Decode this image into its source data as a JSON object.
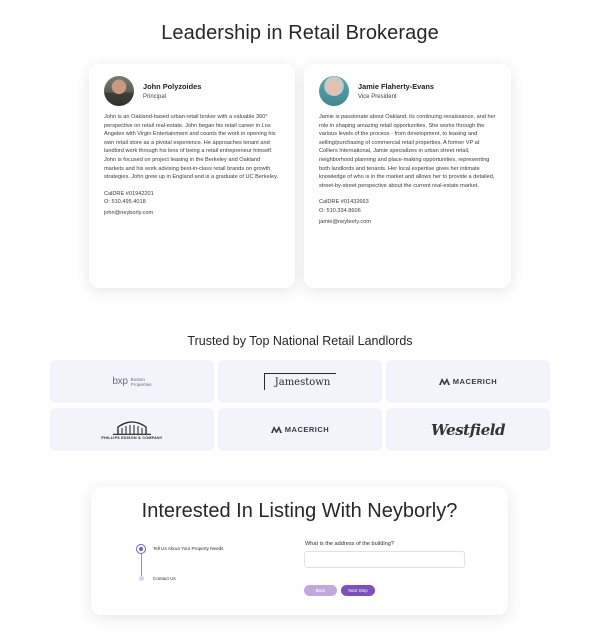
{
  "leadership": {
    "title": "Leadership in Retail Brokerage",
    "people": [
      {
        "name": "John Polyzoides",
        "role": "Principal",
        "bio": "John is an Oakland-based urban retail broker with a valuable 360° perspective on retail real-estate. John began his retail career in Los Angeles with Virgin Entertainment and counts the work in opening his own retail store as a pivotal experience. He approaches tenant and landlord work through his lens of being a retail entrepreneur himself. John is focused on project leasing in the Berkeley and Oakland markets and his work advising best-in-class retail brands on growth strategies. John grew up in England and is a graduate of UC Berkeley.",
        "license": "CalDRE #01942201",
        "phone": "O: 510.495.4018",
        "email": "john@neyborly.com"
      },
      {
        "name": "Jamie Flaherty-Evans",
        "role": "Vice President",
        "bio": "Jamie is passionate about Oakland, its continuing renaissance, and her role in shaping amazing retail opportunities. She works through the various levels of the process - from development, to leasing and selling/purchasing of commercial retail properties. A former VP at Colliers International, Jamie specializes in urban street retail, neighborhood planning and place-making opportunities, representing both landlords and tenants. Her local expertise gives her intimate knowledge of who is in the market and allows her to provide a detailed, street-by-street perspective about the current real-estate market.",
        "license": "CalDRE #01432663",
        "phone": "O: 510.334.8606",
        "email": "jamie@neyborly.com"
      }
    ]
  },
  "landlords": {
    "title": "Trusted by Top National Retail Landlords",
    "logos": {
      "bxp_mark": "bxp",
      "bxp_line1": "Boston",
      "bxp_line2": "Properties",
      "jamestown": "Jamestown",
      "macerich": "MACERICH",
      "phillips": "PHILLIPS EDISON & COMPANY",
      "westfield": "Westfield"
    }
  },
  "listing": {
    "title": "Interested In Listing With Neyborly?",
    "steps": [
      "Tell Us About Your Property Needs",
      "Contact Us"
    ],
    "question": "What is the address of the building?",
    "input_value": "",
    "input_placeholder": "",
    "back_label": "Back",
    "next_label": "Next Step"
  },
  "colors": {
    "accent": "#7d50bd",
    "accent_light": "#c1a8dc",
    "tile_bg": "#f3f3fb"
  }
}
